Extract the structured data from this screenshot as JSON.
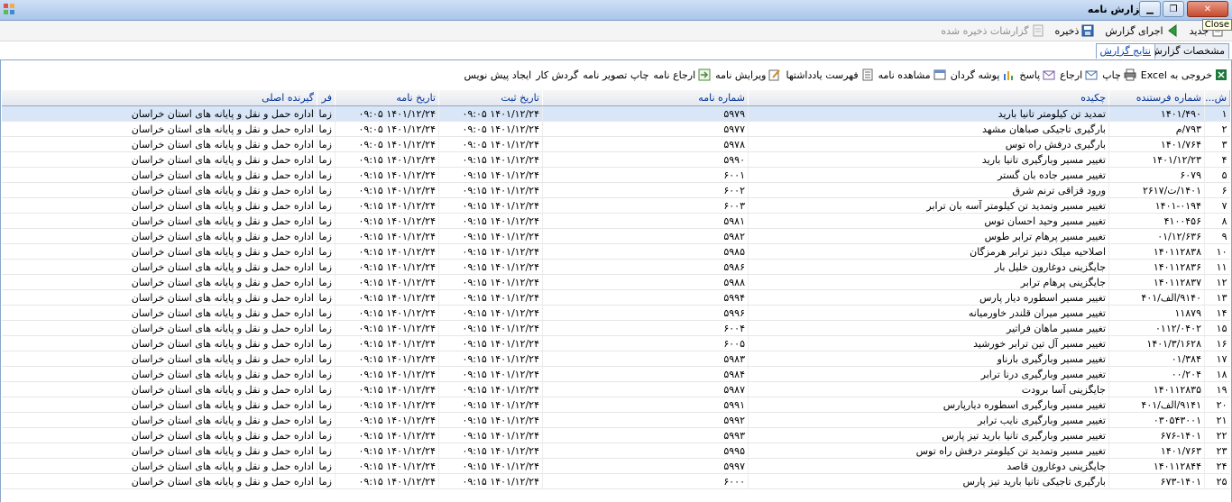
{
  "window": {
    "title": "گزارش نامه",
    "close_tooltip": "Close"
  },
  "menubar": {
    "items": [
      {
        "label": "جدید"
      },
      {
        "label": "اجرای گزارش"
      },
      {
        "label": "ذخیره"
      },
      {
        "label": "گزارشات ذخیره شده"
      }
    ]
  },
  "tabs": [
    {
      "label": "مشخصات گزارش"
    },
    {
      "label": "نتایج گزارش"
    }
  ],
  "toolbar": {
    "items": [
      {
        "label": "خروجی به Excel"
      },
      {
        "label": "چاپ"
      },
      {
        "label": "ارجاع"
      },
      {
        "label": "پاسخ"
      },
      {
        "label": "پوشه گردان"
      },
      {
        "label": "مشاهده نامه"
      },
      {
        "label": "فهرست یادداشتها"
      },
      {
        "label": "ویرایش نامه"
      },
      {
        "label": "ارجاع نامه"
      },
      {
        "label": "چاپ تصویر نامه"
      },
      {
        "label": "گردش کار"
      },
      {
        "label": "ایجاد پیش نویس"
      }
    ]
  },
  "grid": {
    "columns": [
      "ش...",
      "شماره فرستنده",
      "چکیده",
      "شماره نامه",
      "تاریخ ثبت",
      "تاریخ نامه",
      "فر",
      "گیرنده اصلی"
    ],
    "rows": [
      [
        "۱",
        "۱۴۰۱/۴۹۰",
        "تمدید تن کیلومتر تانیا بارید",
        "۵۹۷۹",
        "۱۴۰۱/۱۲/۲۴ ۰۹:۰۵",
        "۱۴۰۱/۱۲/۲۴ ۰۹:۰۵",
        "زما",
        "اداره حمل و نقل و پایانه های استان خراسان"
      ],
      [
        "۲",
        "۷۹۳/م",
        "بارگیری تاجیکی صباهان مشهد",
        "۵۹۷۷",
        "۱۴۰۱/۱۲/۲۴ ۰۹:۰۵",
        "۱۴۰۱/۱۲/۲۴ ۰۹:۰۵",
        "زما",
        "اداره حمل و نقل و پایانه های استان خراسان"
      ],
      [
        "۳",
        "۱۴۰۱/۷۶۴",
        "بارگیری درفش راه توس",
        "۵۹۷۸",
        "۱۴۰۱/۱۲/۲۴ ۰۹:۰۵",
        "۱۴۰۱/۱۲/۲۴ ۰۹:۰۵",
        "زما",
        "اداره حمل و نقل و پایانه های استان خراسان"
      ],
      [
        "۴",
        "۱۴۰۱/۱۲/۲۳",
        "تغییر مسیر وبارگیری تانیا بارید",
        "۵۹۹۰",
        "۱۴۰۱/۱۲/۲۴ ۰۹:۱۵",
        "۱۴۰۱/۱۲/۲۴ ۰۹:۱۵",
        "زما",
        "اداره حمل و نقل و پایانه های استان خراسان"
      ],
      [
        "۵",
        "۶۰۷۹",
        "تغییر مسیر جاده بان گستر",
        "۶۰۰۱",
        "۱۴۰۱/۱۲/۲۴ ۰۹:۱۵",
        "۱۴۰۱/۱۲/۲۴ ۰۹:۱۵",
        "زما",
        "اداره حمل و نقل و پایانه های استان خراسان"
      ],
      [
        "۶",
        "۱۴۰۱/ت/۲۶۱۷",
        "ورود قزاقی ترنم شرق",
        "۶۰۰۲",
        "۱۴۰۱/۱۲/۲۴ ۰۹:۱۵",
        "۱۴۰۱/۱۲/۲۴ ۰۹:۱۵",
        "زما",
        "اداره حمل و نقل و پایانه های استان خراسان"
      ],
      [
        "۷",
        "۱۴۰۱-۰۱۹۴",
        "تغییر مسیر وتمدید تن کیلومتر آسه بان ترابر",
        "۶۰۰۳",
        "۱۴۰۱/۱۲/۲۴ ۰۹:۱۵",
        "۱۴۰۱/۱۲/۲۴ ۰۹:۱۵",
        "زما",
        "اداره حمل و نقل و پایانه های استان خراسان"
      ],
      [
        "۸",
        "۴۱۰۰۴۵۶",
        "تغییر مسیر وحید احسان توس",
        "۵۹۸۱",
        "۱۴۰۱/۱۲/۲۴ ۰۹:۱۵",
        "۱۴۰۱/۱۲/۲۴ ۰۹:۱۵",
        "زما",
        "اداره حمل و نقل و پایانه های استان خراسان"
      ],
      [
        "۹",
        "۰۱/۱۲/۶۳۶",
        "تغییر مسیر پرهام ترابر طوس",
        "۵۹۸۲",
        "۱۴۰۱/۱۲/۲۴ ۰۹:۱۵",
        "۱۴۰۱/۱۲/۲۴ ۰۹:۱۵",
        "زما",
        "اداره حمل و نقل و پایانه های استان خراسان"
      ],
      [
        "۱۰",
        "۱۴۰۱۱۲۸۳۸",
        "اصلاحیه میلک دنیز ترابر هرمزگان",
        "۵۹۸۵",
        "۱۴۰۱/۱۲/۲۴ ۰۹:۱۵",
        "۱۴۰۱/۱۲/۲۴ ۰۹:۱۵",
        "زما",
        "اداره حمل و نقل و پایانه های استان خراسان"
      ],
      [
        "۱۱",
        "۱۴۰۱۱۲۸۳۶",
        "جایگزینی دوغارون خلیل بار",
        "۵۹۸۶",
        "۱۴۰۱/۱۲/۲۴ ۰۹:۱۵",
        "۱۴۰۱/۱۲/۲۴ ۰۹:۱۵",
        "زما",
        "اداره حمل و نقل و پایانه های استان خراسان"
      ],
      [
        "۱۲",
        "۱۴۰۱۱۲۸۳۷",
        "جایگزینی پرهام ترابر",
        "۵۹۸۸",
        "۱۴۰۱/۱۲/۲۴ ۰۹:۱۵",
        "۱۴۰۱/۱۲/۲۴ ۰۹:۱۵",
        "زما",
        "اداره حمل و نقل و پایانه های استان خراسان"
      ],
      [
        "۱۳",
        "۹۱۴۰/الف/۴۰۱",
        "تغییر مسیر اسطوره دیار پارس",
        "۵۹۹۴",
        "۱۴۰۱/۱۲/۲۴ ۰۹:۱۵",
        "۱۴۰۱/۱۲/۲۴ ۰۹:۱۵",
        "زما",
        "اداره حمل و نقل و پایانه های استان خراسان"
      ],
      [
        "۱۴",
        "۱۱۸۷۹",
        "تغییر مسیر میران قلندر خاورمیانه",
        "۵۹۹۶",
        "۱۴۰۱/۱۲/۲۴ ۰۹:۱۵",
        "۱۴۰۱/۱۲/۲۴ ۰۹:۱۵",
        "زما",
        "اداره حمل و نقل و پایانه های استان خراسان"
      ],
      [
        "۱۵",
        "۰۱۱۲/۰۴۰۲",
        "تغییر مسیر ماهان فراتیر",
        "۶۰۰۴",
        "۱۴۰۱/۱۲/۲۴ ۰۹:۱۵",
        "۱۴۰۱/۱۲/۲۴ ۰۹:۱۵",
        "زما",
        "اداره حمل و نقل و پایانه های استان خراسان"
      ],
      [
        "۱۶",
        "۱۴۰۱/۳/۱۶۲۸",
        "تغییر مسیر آل تین ترابر خورشید",
        "۶۰۰۵",
        "۱۴۰۱/۱۲/۲۴ ۰۹:۱۵",
        "۱۴۰۱/۱۲/۲۴ ۰۹:۱۵",
        "زما",
        "اداره حمل و نقل و پایانه های استان خراسان"
      ],
      [
        "۱۷",
        "۰۱/۳۸۴",
        "تغییر مسیر وبارگیری بارناو",
        "۵۹۸۳",
        "۱۴۰۱/۱۲/۲۴ ۰۹:۱۵",
        "۱۴۰۱/۱۲/۲۴ ۰۹:۱۵",
        "زما",
        "اداره حمل و نقل و پایانه های استان خراسان"
      ],
      [
        "۱۸",
        "۰۰/۲۰۴",
        "تغییر مسیر وبارگیری درنا ترابر",
        "۵۹۸۴",
        "۱۴۰۱/۱۲/۲۴ ۰۹:۱۵",
        "۱۴۰۱/۱۲/۲۴ ۰۹:۱۵",
        "زما",
        "اداره حمل و نقل و پایانه های استان خراسان"
      ],
      [
        "۱۹",
        "۱۴۰۱۱۲۸۳۵",
        "جایگزینی آسا برودت",
        "۵۹۸۷",
        "۱۴۰۱/۱۲/۲۴ ۰۹:۱۵",
        "۱۴۰۱/۱۲/۲۴ ۰۹:۱۵",
        "زما",
        "اداره حمل و نقل و پایانه های استان خراسان"
      ],
      [
        "۲۰",
        "۹۱۴۱/الف/۴۰۱",
        "تغییر مسیر وبارگیری اسطوره دیارپارس",
        "۵۹۹۱",
        "۱۴۰۱/۱۲/۲۴ ۰۹:۱۵",
        "۱۴۰۱/۱۲/۲۴ ۰۹:۱۵",
        "زما",
        "اداره حمل و نقل و پایانه های استان خراسان"
      ],
      [
        "۲۱",
        "۰۳۰۵۴۳۰۰۱",
        "تغییر مسیر وبارگیری نایب ترابر",
        "۵۹۹۲",
        "۱۴۰۱/۱۲/۲۴ ۰۹:۱۵",
        "۱۴۰۱/۱۲/۲۴ ۰۹:۱۵",
        "زما",
        "اداره حمل و نقل و پایانه های استان خراسان"
      ],
      [
        "۲۲",
        "۶۷۶-۱۴۰۱",
        "تغییر مسیر وبارگیری تانیا بارید تیز پارس",
        "۵۹۹۳",
        "۱۴۰۱/۱۲/۲۴ ۰۹:۱۵",
        "۱۴۰۱/۱۲/۲۴ ۰۹:۱۵",
        "زما",
        "اداره حمل و نقل و پایانه های استان خراسان"
      ],
      [
        "۲۳",
        "۱۴۰۱/۷۶۳",
        "تغییر مسیر وتمدید تن کیلومتر درفش راه توس",
        "۵۹۹۵",
        "۱۴۰۱/۱۲/۲۴ ۰۹:۱۵",
        "۱۴۰۱/۱۲/۲۴ ۰۹:۱۵",
        "زما",
        "اداره حمل و نقل و پایانه های استان خراسان"
      ],
      [
        "۲۴",
        "۱۴۰۱۱۲۸۴۴",
        "جایگزینی دوغارون قاصد",
        "۵۹۹۷",
        "۱۴۰۱/۱۲/۲۴ ۰۹:۱۵",
        "۱۴۰۱/۱۲/۲۴ ۰۹:۱۵",
        "زما",
        "اداره حمل و نقل و پایانه های استان خراسان"
      ],
      [
        "۲۵",
        "۶۷۳-۱۴۰۱",
        "بارگیری تاجیکی تانیا بارید تیز پارس",
        "۶۰۰۰",
        "۱۴۰۱/۱۲/۲۴ ۰۹:۱۵",
        "۱۴۰۱/۱۲/۲۴ ۰۹:۱۵",
        "زما",
        "اداره حمل و نقل و پایانه های استان خراسان"
      ]
    ]
  }
}
